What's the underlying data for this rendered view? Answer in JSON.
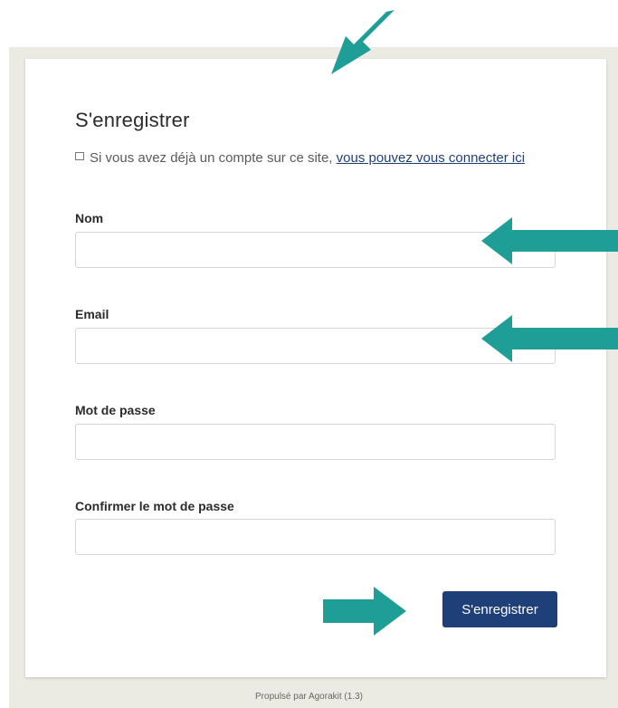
{
  "form": {
    "title": "S'enregistrer",
    "info_prefix": "Si vous avez déjà un compte sur ce site, ",
    "info_link": "vous pouvez vous connecter ici",
    "fields": [
      {
        "label": "Nom",
        "value": ""
      },
      {
        "label": "Email",
        "value": ""
      },
      {
        "label": "Mot de passe",
        "value": ""
      },
      {
        "label": "Confirmer le mot de passe",
        "value": ""
      }
    ],
    "submit_label": "S'enregistrer"
  },
  "footer": {
    "text": "Propulsé par Agorakit (1.3)"
  },
  "colors": {
    "background": "#ecebe3",
    "card": "#ffffff",
    "accent": "#1f3f78",
    "annotation_arrow": "#1f9e98"
  },
  "annotations": [
    "arrow-icon",
    "arrow-icon",
    "arrow-icon",
    "arrow-icon"
  ]
}
